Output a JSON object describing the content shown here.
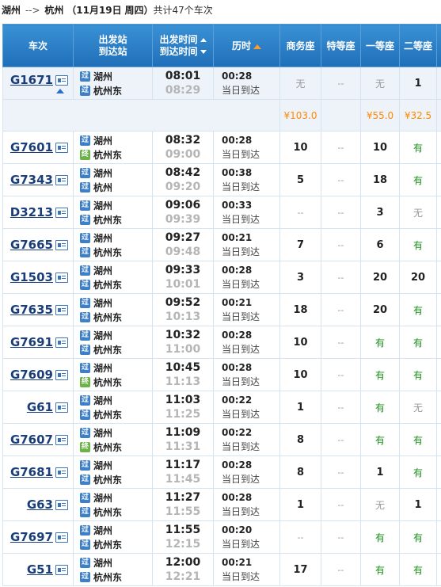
{
  "route": {
    "from": "湖州",
    "arrow": "-->",
    "to": "杭州",
    "date_open": "（",
    "date": "11月19日",
    "weekday": "周四",
    "date_close": "）",
    "count_text": "共计47个车次"
  },
  "headers": {
    "train": "车次",
    "from_station": "出发站",
    "to_station": "到达站",
    "dep_time": "出发时间",
    "arr_time": "到达时间",
    "duration": "历时",
    "business": "商务座",
    "special": "特等座",
    "first": "一等座",
    "second": "二等座"
  },
  "badges": {
    "pass": "过",
    "end": "终"
  },
  "trains": [
    {
      "no": "G1671",
      "from": "湖州",
      "from_badge": "过",
      "to": "杭州东",
      "to_badge": "过",
      "dep": "08:01",
      "arr": "08:29",
      "dur": "00:28",
      "day": "当日到达",
      "business": "无",
      "special": "--",
      "first": "无",
      "second": "1",
      "expanded": true
    },
    {
      "no": "G7601",
      "from": "湖州",
      "from_badge": "过",
      "to": "杭州东",
      "to_badge": "终",
      "dep": "08:32",
      "arr": "09:00",
      "dur": "00:28",
      "day": "当日到达",
      "business": "10",
      "special": "--",
      "first": "10",
      "second": "有"
    },
    {
      "no": "G7343",
      "from": "湖州",
      "from_badge": "过",
      "to": "杭州",
      "to_badge": "过",
      "dep": "08:42",
      "arr": "09:20",
      "dur": "00:38",
      "day": "当日到达",
      "business": "5",
      "special": "--",
      "first": "18",
      "second": "有"
    },
    {
      "no": "D3213",
      "from": "湖州",
      "from_badge": "过",
      "to": "杭州东",
      "to_badge": "过",
      "dep": "09:06",
      "arr": "09:39",
      "dur": "00:33",
      "day": "当日到达",
      "business": "--",
      "special": "--",
      "first": "3",
      "second": "无"
    },
    {
      "no": "G7665",
      "from": "湖州",
      "from_badge": "过",
      "to": "杭州东",
      "to_badge": "过",
      "dep": "09:27",
      "arr": "09:48",
      "dur": "00:21",
      "day": "当日到达",
      "business": "7",
      "special": "--",
      "first": "6",
      "second": "有"
    },
    {
      "no": "G1503",
      "from": "湖州",
      "from_badge": "过",
      "to": "杭州东",
      "to_badge": "过",
      "dep": "09:33",
      "arr": "10:01",
      "dur": "00:28",
      "day": "当日到达",
      "business": "3",
      "special": "--",
      "first": "20",
      "second": "20"
    },
    {
      "no": "G7635",
      "from": "湖州",
      "from_badge": "过",
      "to": "杭州东",
      "to_badge": "过",
      "dep": "09:52",
      "arr": "10:13",
      "dur": "00:21",
      "day": "当日到达",
      "business": "18",
      "special": "--",
      "first": "20",
      "second": "有"
    },
    {
      "no": "G7691",
      "from": "湖州",
      "from_badge": "过",
      "to": "杭州东",
      "to_badge": "过",
      "dep": "10:32",
      "arr": "11:00",
      "dur": "00:28",
      "day": "当日到达",
      "business": "10",
      "special": "--",
      "first": "有",
      "second": "有"
    },
    {
      "no": "G7609",
      "from": "湖州",
      "from_badge": "过",
      "to": "杭州东",
      "to_badge": "终",
      "dep": "10:45",
      "arr": "11:13",
      "dur": "00:28",
      "day": "当日到达",
      "business": "10",
      "special": "--",
      "first": "有",
      "second": "有"
    },
    {
      "no": "G61",
      "from": "湖州",
      "from_badge": "过",
      "to": "杭州东",
      "to_badge": "过",
      "dep": "11:03",
      "arr": "11:25",
      "dur": "00:22",
      "day": "当日到达",
      "business": "1",
      "special": "--",
      "first": "有",
      "second": "无"
    },
    {
      "no": "G7607",
      "from": "湖州",
      "from_badge": "过",
      "to": "杭州东",
      "to_badge": "终",
      "dep": "11:09",
      "arr": "11:31",
      "dur": "00:22",
      "day": "当日到达",
      "business": "8",
      "special": "--",
      "first": "有",
      "second": "有"
    },
    {
      "no": "G7681",
      "from": "湖州",
      "from_badge": "过",
      "to": "杭州东",
      "to_badge": "过",
      "dep": "11:17",
      "arr": "11:45",
      "dur": "00:28",
      "day": "当日到达",
      "business": "8",
      "special": "--",
      "first": "1",
      "second": "有"
    },
    {
      "no": "G63",
      "from": "湖州",
      "from_badge": "过",
      "to": "杭州东",
      "to_badge": "过",
      "dep": "11:27",
      "arr": "11:55",
      "dur": "00:28",
      "day": "当日到达",
      "business": "1",
      "special": "--",
      "first": "无",
      "second": "1"
    },
    {
      "no": "G7697",
      "from": "湖州",
      "from_badge": "过",
      "to": "杭州东",
      "to_badge": "过",
      "dep": "11:55",
      "arr": "12:15",
      "dur": "00:20",
      "day": "当日到达",
      "business": "--",
      "special": "--",
      "first": "有",
      "second": "有"
    },
    {
      "no": "G51",
      "from": "湖州",
      "from_badge": "过",
      "to": "杭州东",
      "to_badge": "过",
      "dep": "12:00",
      "arr": "12:21",
      "dur": "00:21",
      "day": "当日到达",
      "business": "17",
      "special": "--",
      "first": "有",
      "second": "有"
    }
  ],
  "price_row": {
    "business": "¥103.0",
    "special": "",
    "first": "¥55.0",
    "second": "¥32.5"
  },
  "colors": {
    "header_top": "#3a91d5",
    "header_bottom": "#1f6fb8",
    "train_link": "#1a3e7a",
    "price": "#ff8800",
    "available": "#1d8f1d",
    "alt_row": "#eef3fa"
  }
}
